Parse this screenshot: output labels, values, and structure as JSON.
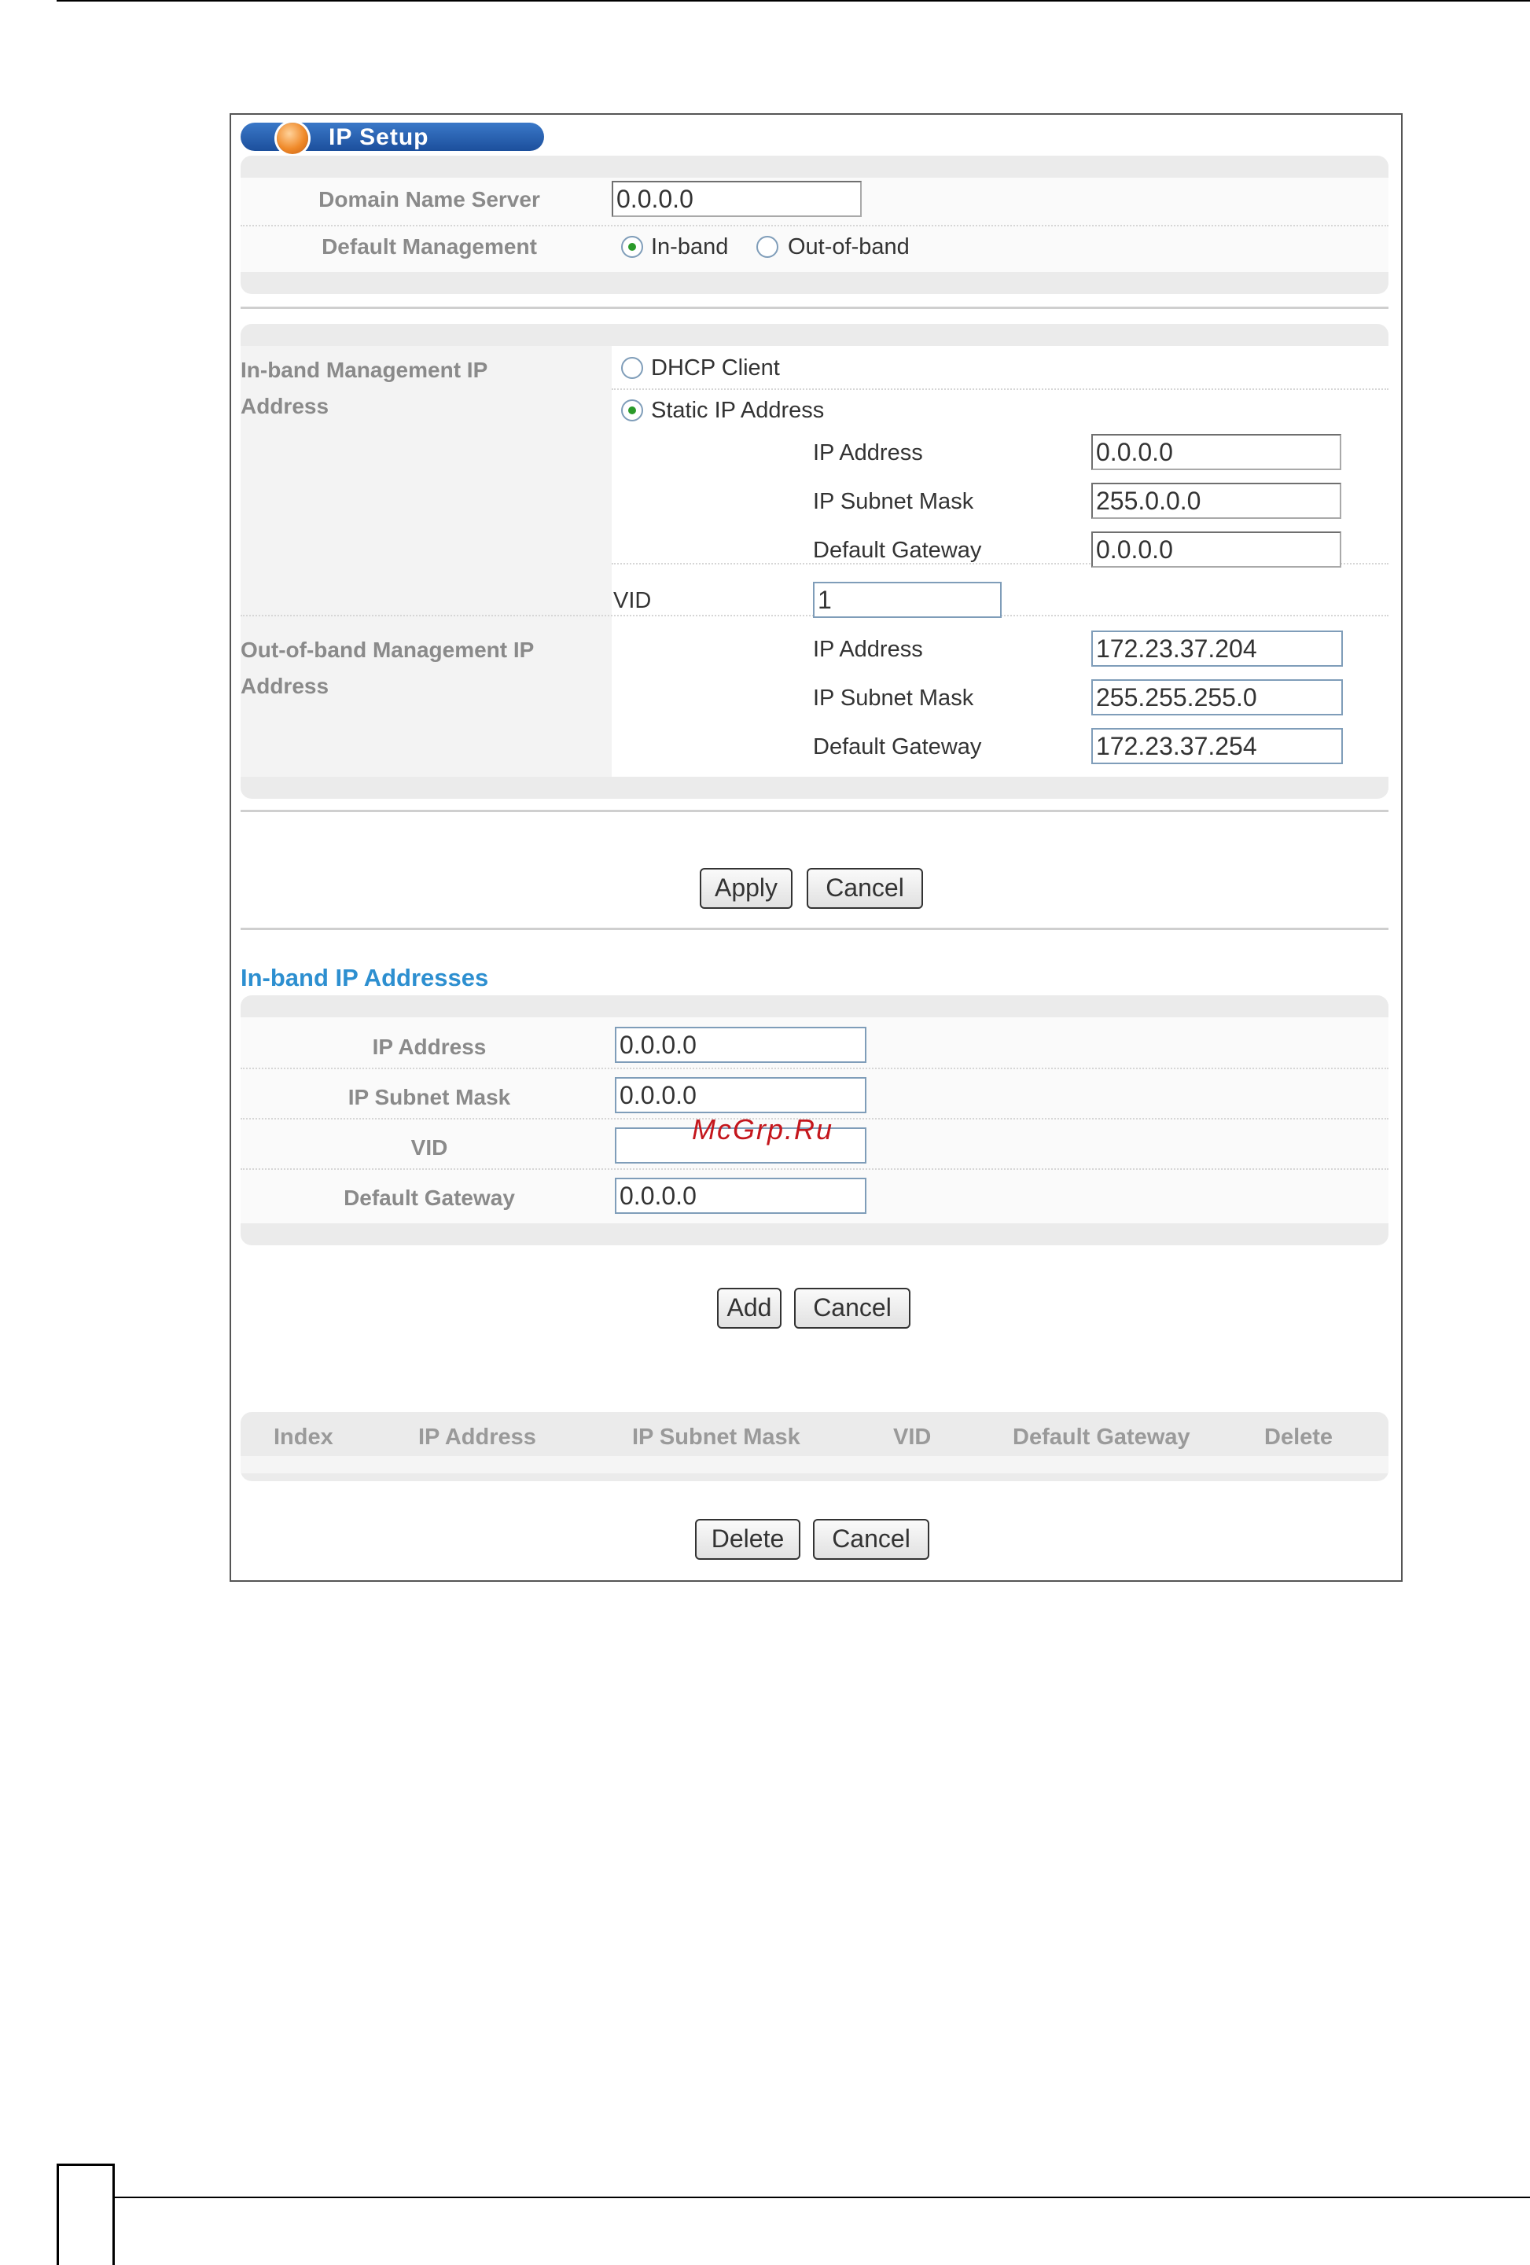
{
  "banner": {
    "title": "IP Setup"
  },
  "general": {
    "dns_label": "Domain Name Server",
    "dns_value": "0.0.0.0",
    "default_mgmt_label": "Default Management",
    "opt_inband": "In-band",
    "opt_outband": "Out-of-band",
    "selected": "In-band"
  },
  "inband_mgmt": {
    "label": "In-band Management IP Address",
    "dhcp_label": "DHCP Client",
    "static_label": "Static IP Address",
    "selected": "Static IP Address",
    "ip_label": "IP Address",
    "ip_value": "0.0.0.0",
    "mask_label": "IP Subnet Mask",
    "mask_value": "255.0.0.0",
    "gw_label": "Default Gateway",
    "gw_value": "0.0.0.0",
    "vid_label": "VID",
    "vid_value": "1"
  },
  "outband_mgmt": {
    "label": "Out-of-band Management IP Address",
    "ip_label": "IP Address",
    "ip_value": "172.23.37.204",
    "mask_label": "IP Subnet Mask",
    "mask_value": "255.255.255.0",
    "gw_label": "Default Gateway",
    "gw_value": "172.23.37.254"
  },
  "actions1": {
    "apply": "Apply",
    "cancel": "Cancel"
  },
  "inband_addrs": {
    "title": "In-band IP Addresses",
    "ip_label": "IP Address",
    "ip_value": "0.0.0.0",
    "mask_label": "IP Subnet Mask",
    "mask_value": "0.0.0.0",
    "vid_label": "VID",
    "vid_value": "",
    "gw_label": "Default Gateway",
    "gw_value": "0.0.0.0"
  },
  "actions2": {
    "add": "Add",
    "cancel": "Cancel"
  },
  "table": {
    "columns": [
      "Index",
      "IP Address",
      "IP Subnet Mask",
      "VID",
      "Default Gateway",
      "Delete"
    ]
  },
  "actions3": {
    "delete": "Delete",
    "cancel": "Cancel"
  },
  "watermark": "McGrp.Ru"
}
